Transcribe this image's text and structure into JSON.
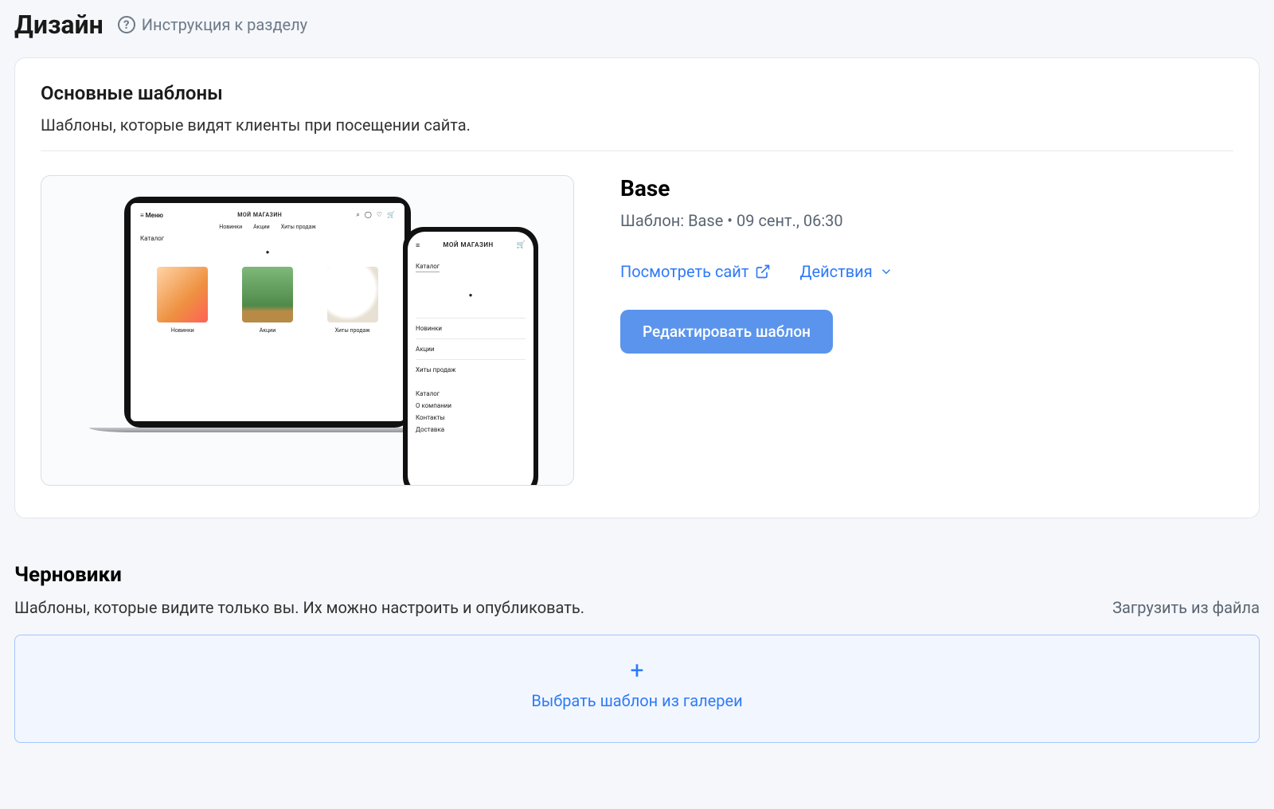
{
  "header": {
    "title": "Дизайн",
    "help_label": "Инструкция к разделу"
  },
  "main_card": {
    "section_title": "Основные шаблоны",
    "section_desc": "Шаблоны, которые видят клиенты при посещении сайта.",
    "template": {
      "name": "Base",
      "meta": "Шаблон: Base • 09 сент., 06:30",
      "preview_link": "Посмотреть сайт",
      "actions_label": "Действия",
      "edit_button": "Редактировать шаблон"
    },
    "preview": {
      "laptop": {
        "menu_label": "≡  Меню",
        "brand": "МОЙ МАГАЗИН",
        "tabs": [
          "Новинки",
          "Акции",
          "Хиты продаж"
        ],
        "side": "Каталог",
        "prod_labels": [
          "Новинки",
          "Акции",
          "Хиты продаж"
        ]
      },
      "phone": {
        "brand": "МОЙ МАГАЗИН",
        "catalog_tab": "Каталог",
        "list": [
          "Новинки",
          "Акции",
          "Хиты продаж"
        ],
        "footer": [
          "Каталог",
          "О компании",
          "Контакты",
          "Доставка"
        ]
      }
    }
  },
  "drafts": {
    "title": "Черновики",
    "desc": "Шаблоны, которые видите только вы. Их можно настроить и опубликовать.",
    "upload_link": "Загрузить из файла",
    "gallery_button": "Выбрать шаблон из галереи"
  }
}
